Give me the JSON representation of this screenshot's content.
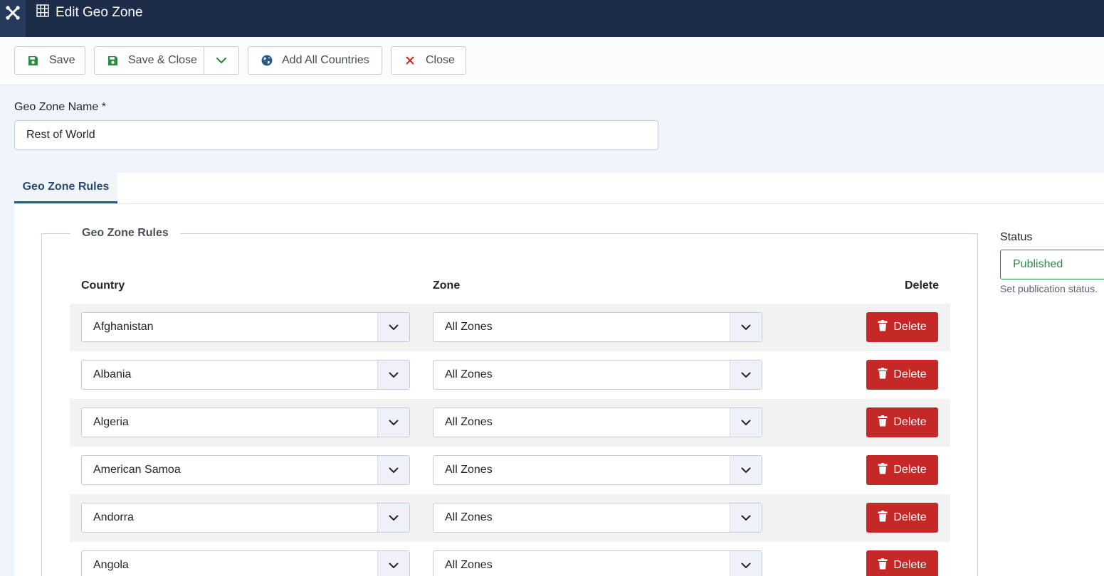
{
  "header": {
    "title": "Edit Geo Zone",
    "icons": {
      "logo": "joomla-logo-icon",
      "title": "grid-icon"
    }
  },
  "toolbar": {
    "save_label": "Save",
    "save_close_label": "Save & Close",
    "add_all_label": "Add All Countries",
    "close_label": "Close",
    "icons": {
      "save": "floppy-disk-icon",
      "dropdown": "chevron-down-icon",
      "add_all": "globe-icon",
      "close": "x-icon"
    }
  },
  "form": {
    "name_label": "Geo Zone Name *",
    "name_value": "Rest of World"
  },
  "tabs": [
    {
      "label": "Geo Zone Rules"
    }
  ],
  "rules": {
    "legend": "Geo Zone Rules",
    "headers": {
      "country": "Country",
      "zone": "Zone",
      "delete": "Delete"
    },
    "delete_label": "Delete",
    "rows": [
      {
        "country": "Afghanistan",
        "zone": "All Zones"
      },
      {
        "country": "Albania",
        "zone": "All Zones"
      },
      {
        "country": "Algeria",
        "zone": "All Zones"
      },
      {
        "country": "American Samoa",
        "zone": "All Zones"
      },
      {
        "country": "Andorra",
        "zone": "All Zones"
      },
      {
        "country": "Angola",
        "zone": "All Zones"
      }
    ]
  },
  "sidebar": {
    "status_label": "Status",
    "status_value": "Published",
    "status_help": "Set publication status."
  },
  "colors": {
    "header_bg": "#1c2b47",
    "delete_red": "#c52827",
    "published_green": "#2e8b47",
    "tab_accent": "#2a5a8a"
  }
}
